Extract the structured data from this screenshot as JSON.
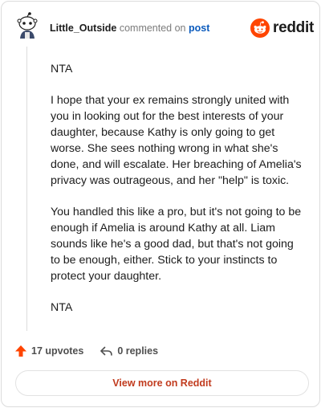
{
  "comment": {
    "username": "Little_Outside",
    "action": "commented on",
    "target": "post",
    "paragraphs": [
      "NTA",
      "I hope that your ex remains strongly united with you in looking out for the best interests of your daughter, because Kathy is only going to get worse. She sees nothing wrong in what she's done, and will escalate. Her breaching of Amelia's privacy was outrageous, and her \"help\" is toxic.",
      "You handled this like a pro, but it's not going to be enough if Amelia is around Kathy at all. Liam sounds like he's a good dad, but that's not going to be enough, either. Stick to your instincts to protect your daughter.",
      "NTA"
    ]
  },
  "brand": {
    "wordmark": "reddit",
    "icon": "reddit-logo-icon",
    "color": "#ff4500"
  },
  "footer": {
    "upvotes_label": "17 upvotes",
    "upvote_icon": "upvote-arrow-icon",
    "upvote_color": "#ff4500",
    "replies_label": "0 replies",
    "reply_icon": "reply-arrow-icon"
  },
  "cta": {
    "label": "View more on Reddit",
    "color": "#c13b1e"
  }
}
